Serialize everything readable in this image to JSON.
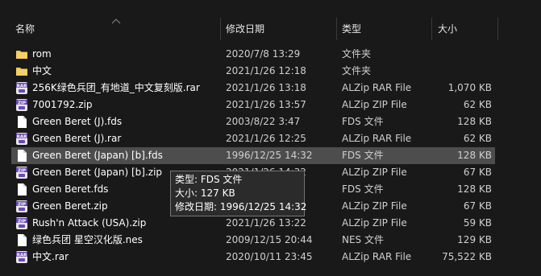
{
  "columns": {
    "name": "名称",
    "date": "修改日期",
    "type": "类型",
    "size": "大小"
  },
  "files": [
    {
      "name": "rom",
      "date": "2020/7/8 13:29",
      "type": "文件夹",
      "size": "",
      "icon": "folder-icon"
    },
    {
      "name": "中文",
      "date": "2021/1/26 12:18",
      "type": "文件夹",
      "size": "",
      "icon": "folder-icon"
    },
    {
      "name": "256K绿色兵团_有地道_中文复刻版.rar",
      "date": "2021/1/26 13:18",
      "type": "ALZip RAR File",
      "size": "1,070 KB",
      "icon": "rar-archive-icon"
    },
    {
      "name": "7001792.zip",
      "date": "2021/1/26 13:57",
      "type": "ALZip ZIP File",
      "size": "62 KB",
      "icon": "zip-archive-icon"
    },
    {
      "name": "Green Beret (J).fds",
      "date": "2003/8/22 3:47",
      "type": "FDS 文件",
      "size": "128 KB",
      "icon": "document-icon"
    },
    {
      "name": "Green Beret (J).rar",
      "date": "2021/1/26 12:25",
      "type": "ALZip RAR File",
      "size": "62 KB",
      "icon": "rar-archive-icon"
    },
    {
      "name": "Green Beret (Japan) [b].fds",
      "date": "1996/12/25 14:32",
      "type": "FDS 文件",
      "size": "128 KB",
      "icon": "document-icon"
    },
    {
      "name": "Green Beret (Japan) [b].zip",
      "date": "2021/1/26 14:32",
      "type": "ALZip ZIP File",
      "size": "67 KB",
      "icon": "zip-archive-icon"
    },
    {
      "name": "Green Beret.fds",
      "date": "",
      "type": "FDS 文件",
      "size": "128 KB",
      "icon": "document-icon"
    },
    {
      "name": "Green Beret.zip",
      "date": "",
      "type": "ALZip ZIP File",
      "size": "67 KB",
      "icon": "zip-archive-icon"
    },
    {
      "name": "Rush'n Attack (USA).zip",
      "date": "2021/1/26 13:22",
      "type": "ALZip ZIP File",
      "size": "59 KB",
      "icon": "zip-archive-icon"
    },
    {
      "name": "绿色兵团 星空汉化版.nes",
      "date": "2009/12/15 20:44",
      "type": "NES 文件",
      "size": "129 KB",
      "icon": "document-icon"
    },
    {
      "name": "中文.rar",
      "date": "2020/10/11 23:45",
      "type": "ALZip RAR File",
      "size": "75,522 KB",
      "icon": "rar-archive-icon"
    }
  ],
  "tooltip": {
    "type_line": "类型: FDS 文件",
    "size_line": "大小: 127 KB",
    "date_line": "修改日期: 1996/12/25 14:32"
  },
  "colors": {
    "background": "#191919",
    "hover_row": "#4d4d4d",
    "folder": "#f3c54a",
    "archive_badge": "#6b4ab5"
  }
}
